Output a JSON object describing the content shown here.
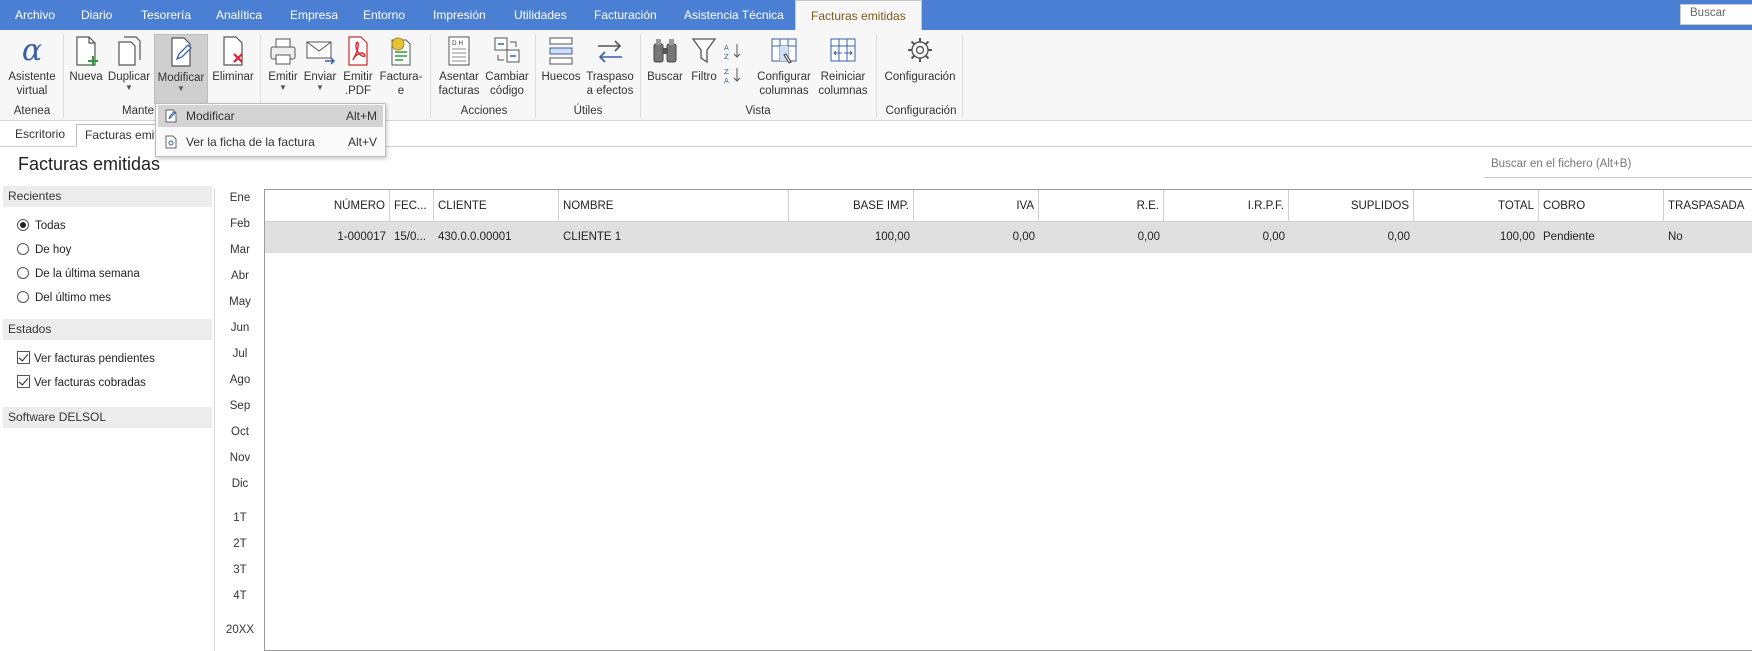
{
  "menu": {
    "items": [
      "Archivo",
      "Diario",
      "Tesorería",
      "Analítica",
      "Empresa",
      "Entorno",
      "Impresión",
      "Utilidades",
      "Facturación",
      "Asistencia Técnica"
    ],
    "active": "Facturas emitidas",
    "search_placeholder": "Buscar"
  },
  "ribbon": {
    "asistente": [
      "Asistente",
      "virtual"
    ],
    "nueva": "Nueva",
    "duplicar": "Duplicar",
    "modificar": "Modificar",
    "eliminar": "Eliminar",
    "emitir": "Emitir",
    "enviar": "Enviar",
    "emitir_pdf": [
      "Emitir",
      ".PDF"
    ],
    "factura_e": [
      "Factura-",
      "e"
    ],
    "asentar": [
      "Asentar",
      "facturas"
    ],
    "cambiar": [
      "Cambiar",
      "código"
    ],
    "huecos": "Huecos",
    "traspaso": [
      "Traspaso",
      "a efectos"
    ],
    "buscar": "Buscar",
    "filtro": "Filtro",
    "configurar": [
      "Configurar",
      "columnas"
    ],
    "reiniciar": [
      "Reiniciar",
      "columnas"
    ],
    "configuracion": "Configuración",
    "groups": {
      "atenea": "Atenea",
      "mante": "Mante",
      "acciones": "Acciones",
      "utiles": "Útiles",
      "vista": "Vista",
      "configuracion": "Configuración"
    }
  },
  "dropdown": {
    "items": [
      {
        "label": "Modificar",
        "shortcut": "Alt+M"
      },
      {
        "label": "Ver la ficha de la factura",
        "shortcut": "Alt+V"
      }
    ]
  },
  "tabs": [
    "Escritorio",
    "Facturas emiti"
  ],
  "page": {
    "title": "Facturas emitidas",
    "search_placeholder": "Buscar en el fichero (Alt+B)"
  },
  "left": {
    "recientes_header": "Recientes",
    "recientes": [
      {
        "label": "Todas",
        "selected": true
      },
      {
        "label": "De hoy",
        "selected": false
      },
      {
        "label": "De la última semana",
        "selected": false
      },
      {
        "label": "Del último mes",
        "selected": false
      }
    ],
    "estados_header": "Estados",
    "estados": [
      {
        "label": "Ver facturas pendientes",
        "checked": true
      },
      {
        "label": "Ver facturas cobradas",
        "checked": true
      }
    ],
    "software_header": "Software DELSOL"
  },
  "months": [
    "Ene",
    "Feb",
    "Mar",
    "Abr",
    "May",
    "Jun",
    "Jul",
    "Ago",
    "Sep",
    "Oct",
    "Nov",
    "Dic"
  ],
  "quarters": [
    "1T",
    "2T",
    "3T",
    "4T"
  ],
  "year": "20XX",
  "table": {
    "columns": [
      "NÚMERO",
      "FEC...",
      "CLIENTE",
      "NOMBRE",
      "BASE IMP.",
      "IVA",
      "R.E.",
      "I.R.P.F.",
      "SUPLIDOS",
      "TOTAL",
      "COBRO",
      "TRASPASADA"
    ],
    "rows": [
      [
        "1-000017",
        "15/0...",
        "430.0.0.00001",
        "CLIENTE 1",
        "100,00",
        "0,00",
        "0,00",
        "0,00",
        "0,00",
        "100,00",
        "Pendiente",
        "No"
      ]
    ]
  }
}
